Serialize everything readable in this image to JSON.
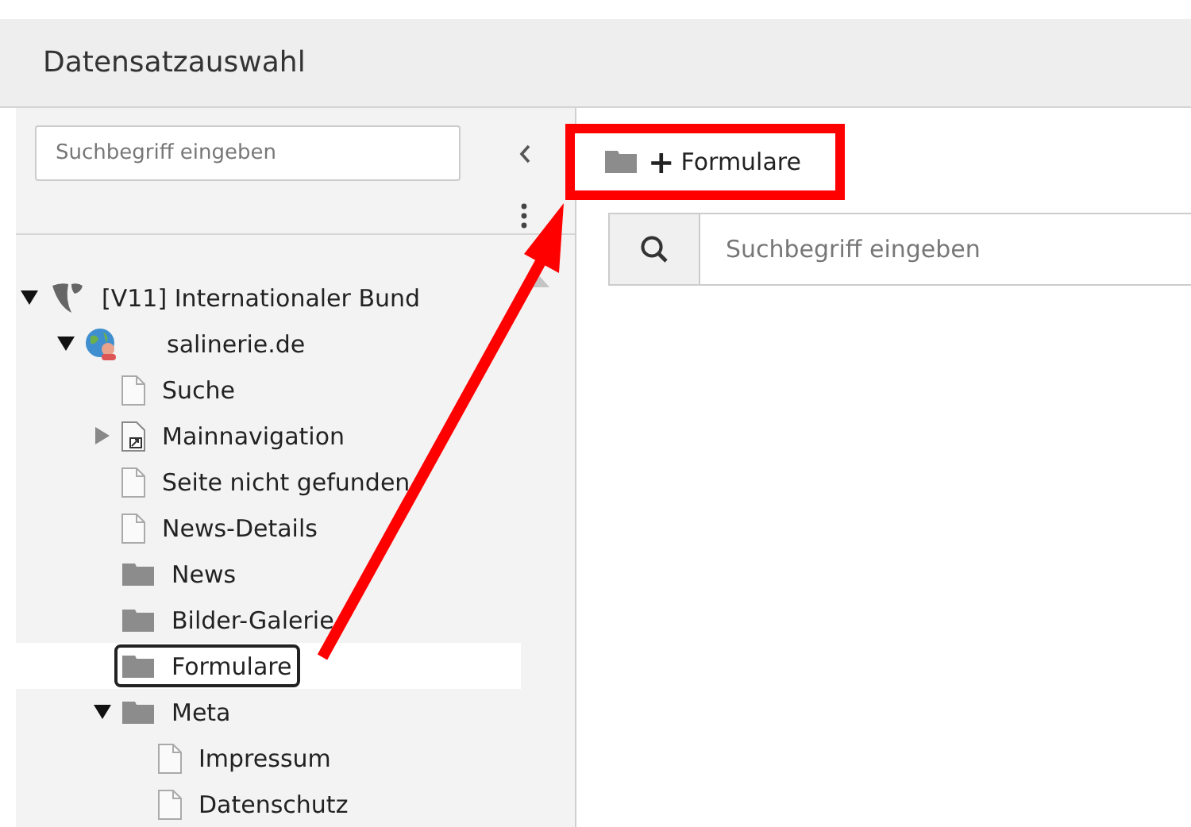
{
  "window": {
    "title": "Datensatzauswahl"
  },
  "sidebar": {
    "search": {
      "placeholder": "Suchbegriff eingeben"
    },
    "tree": [
      {
        "label": "[V11] Internationaler Bund",
        "kind": "site-root",
        "expanded": true,
        "selected": false,
        "children": [
          {
            "label": "salinerie.de",
            "kind": "site",
            "expanded": true,
            "selected": false,
            "children": [
              {
                "label": "Suche",
                "kind": "page",
                "selected": false
              },
              {
                "label": "Mainnavigation",
                "kind": "shortcut",
                "expanded": false,
                "selected": false
              },
              {
                "label": "Seite nicht gefunden",
                "kind": "page",
                "selected": false
              },
              {
                "label": "News-Details",
                "kind": "page",
                "selected": false
              },
              {
                "label": "News",
                "kind": "folder",
                "selected": false
              },
              {
                "label": "Bilder-Galerie",
                "kind": "folder",
                "selected": false
              },
              {
                "label": "Formulare",
                "kind": "folder",
                "selected": true
              },
              {
                "label": "Meta",
                "kind": "folder",
                "expanded": true,
                "selected": false,
                "children": [
                  {
                    "label": "Impressum",
                    "kind": "page",
                    "selected": false
                  },
                  {
                    "label": "Datenschutz",
                    "kind": "page",
                    "selected": false
                  }
                ]
              }
            ]
          }
        ]
      }
    ]
  },
  "content": {
    "breadcrumb": {
      "plus": "+",
      "label": "Formulare"
    },
    "search": {
      "placeholder": "Suchbegriff eingeben"
    }
  }
}
